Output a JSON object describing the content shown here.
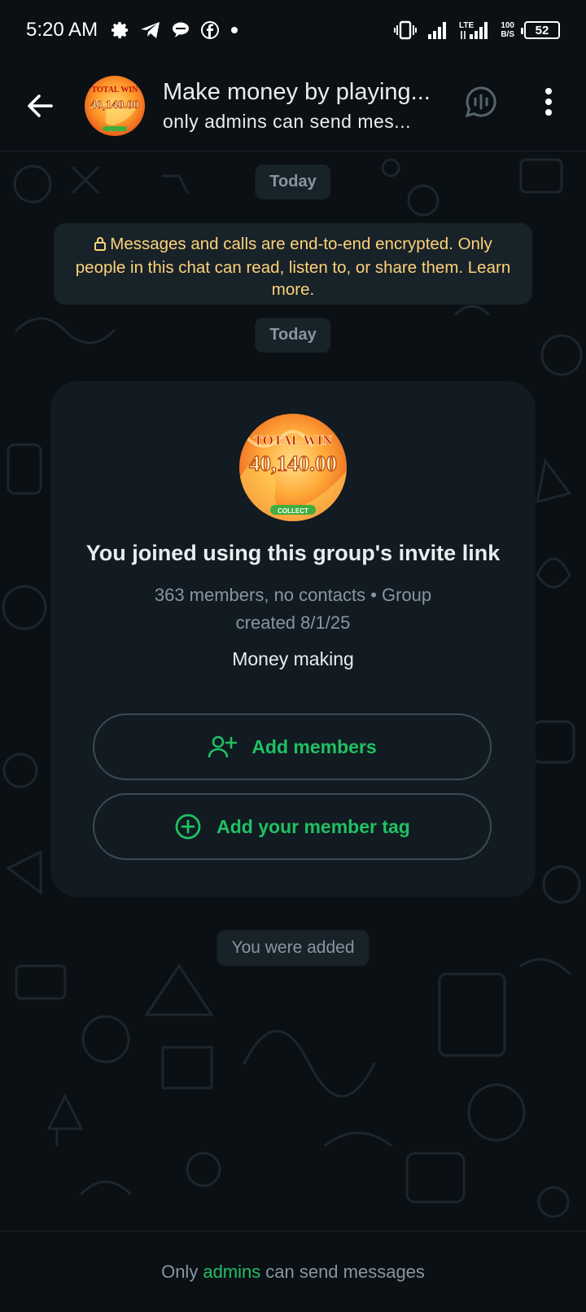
{
  "status_bar": {
    "time": "5:20 AM",
    "network_label": "LTE",
    "speed_value": "100",
    "speed_unit": "B/S",
    "battery": "52",
    "icons": [
      "gear-icon",
      "telegram-icon",
      "chat-bubble-icon",
      "facebook-icon",
      "dot-icon",
      "vibrate-icon",
      "signal-icon",
      "lte-signal-icon",
      "battery-icon"
    ]
  },
  "header": {
    "title": "Make money by playing...",
    "subtitle": "only admins can send mes...",
    "avatar_text_top": "TOTAL WIN",
    "avatar_text_main": "40,140.00"
  },
  "chat": {
    "date_chip_1": "Today",
    "encryption_notice": "Messages and calls are end-to-end encrypted. Only people in this chat can read, listen to, or share them. Learn more.",
    "date_chip_2": "Today",
    "system_message": "You were added"
  },
  "group_card": {
    "avatar_text_top": "TOTAL WIN",
    "avatar_text_main": "40,140.00",
    "avatar_text_bottom": "COLLECT",
    "title": "You joined using this group's invite link",
    "meta": "363 members, no contacts • Group created 8/1/25",
    "description": "Money making",
    "add_members_label": "Add members",
    "add_tag_label": "Add your member tag"
  },
  "footer": {
    "prefix": "Only",
    "highlight": "admins",
    "suffix": "can send messages"
  },
  "colors": {
    "background": "#0b1014",
    "accent_green": "#21c063",
    "encryption_yellow": "#ffd279",
    "chip_background": "#182229",
    "muted_text": "#8696a0"
  }
}
